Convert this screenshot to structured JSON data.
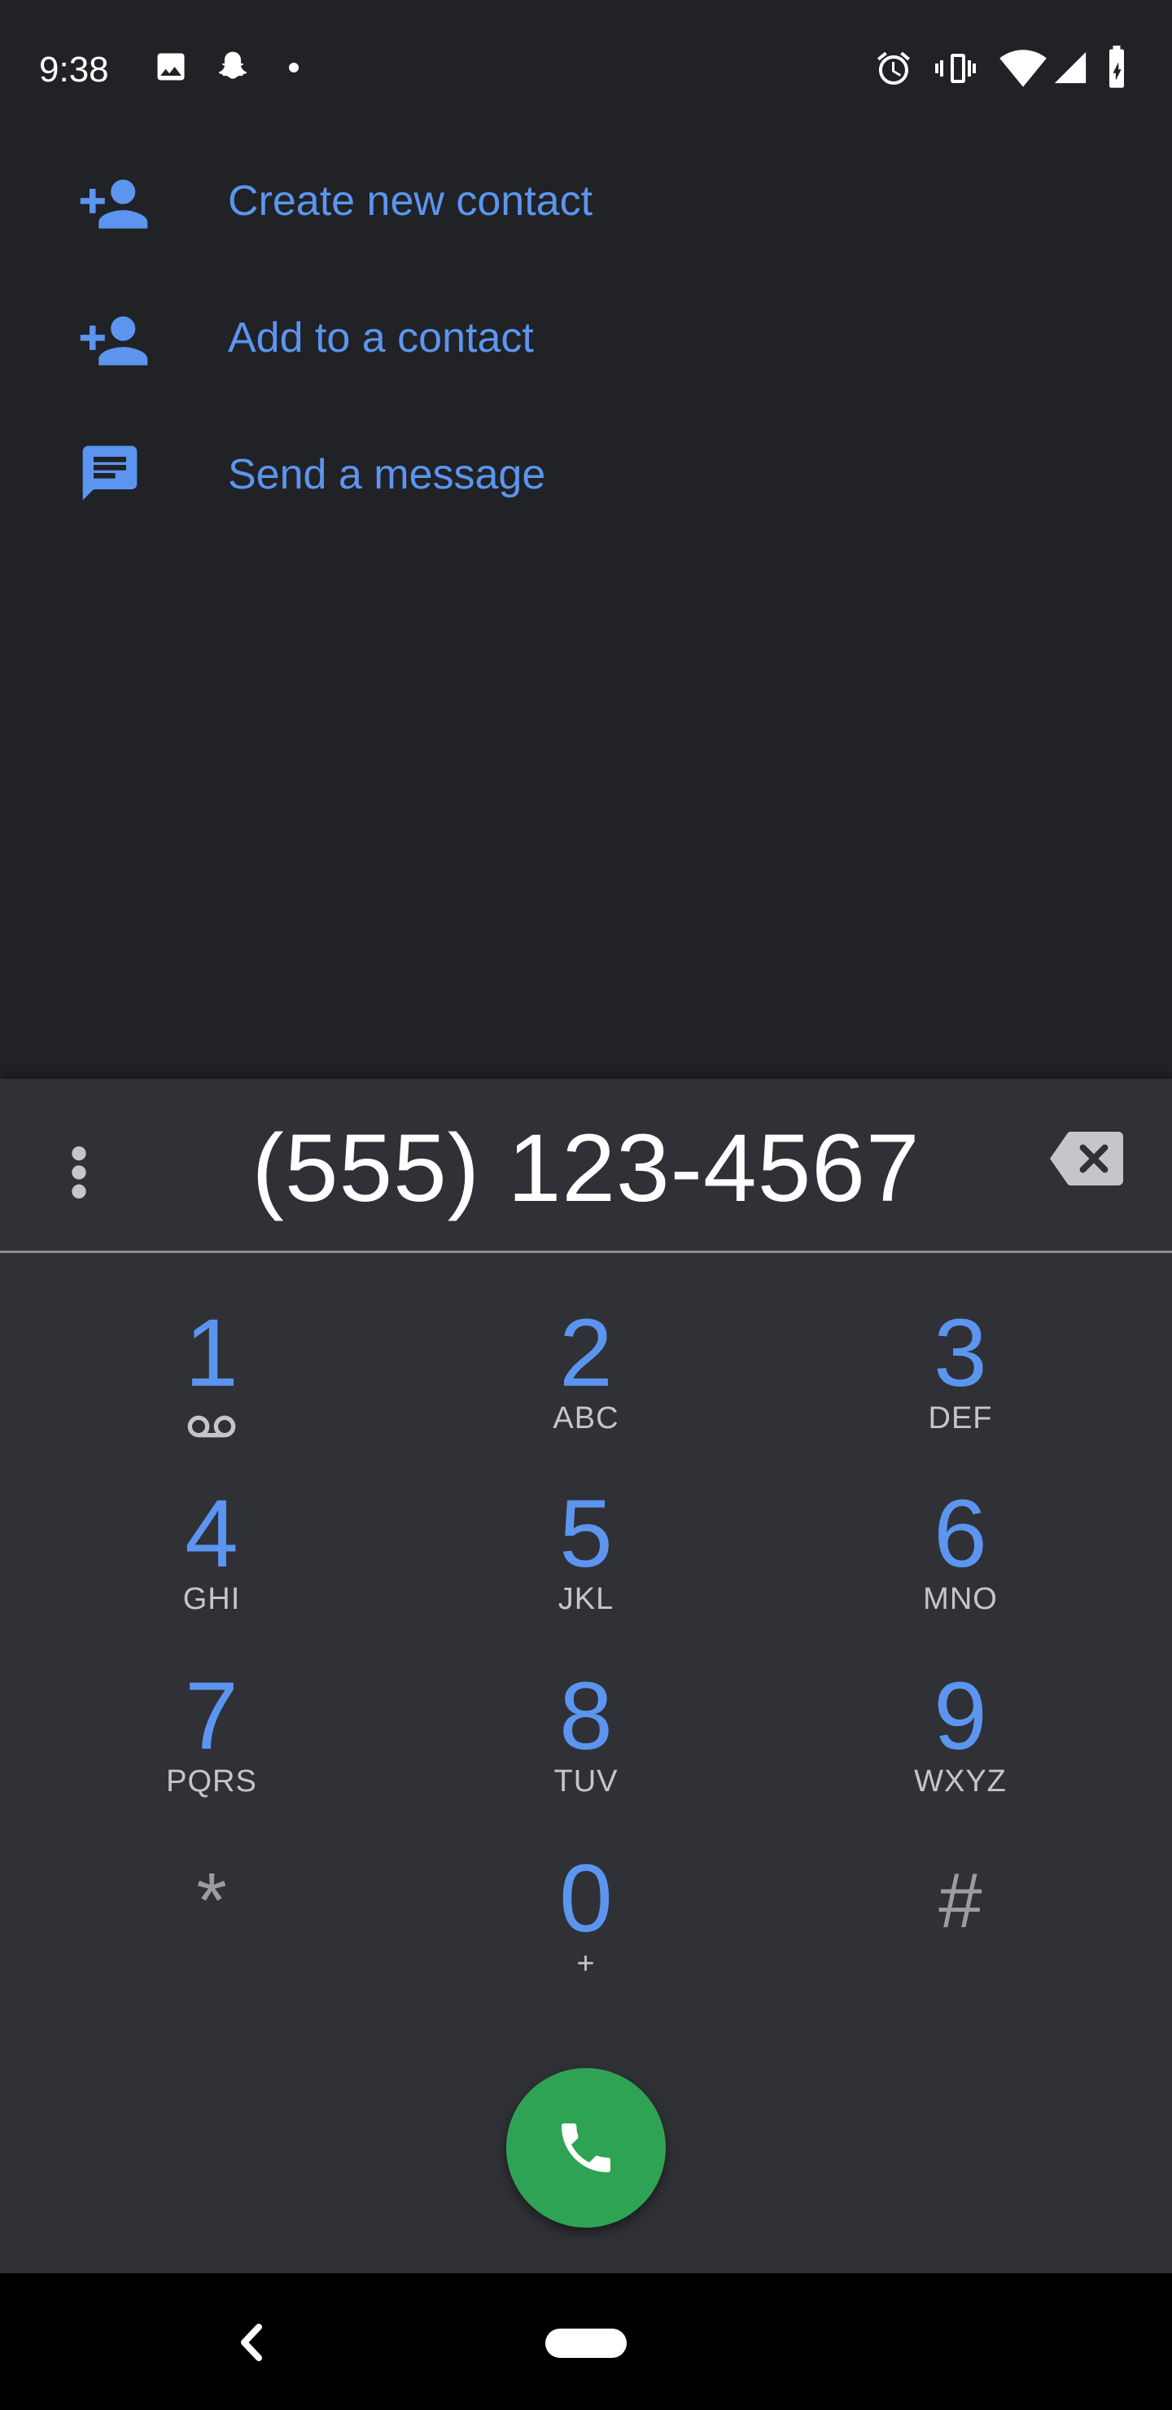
{
  "status_bar": {
    "time": "9:38",
    "icons": [
      "image-icon",
      "snapchat-icon",
      "dot-icon",
      "alarm-icon",
      "vibrate-icon",
      "wifi-icon",
      "signal-icon",
      "battery-charging-icon"
    ]
  },
  "suggestions": [
    {
      "label": "Create new contact",
      "icon": "person-add-icon"
    },
    {
      "label": "Add to a contact",
      "icon": "person-add-icon"
    },
    {
      "label": "Send a message",
      "icon": "message-icon"
    }
  ],
  "dialpad": {
    "digits": "(555) 123-4567",
    "keys": [
      {
        "num": "1",
        "letters": ""
      },
      {
        "num": "2",
        "letters": "ABC"
      },
      {
        "num": "3",
        "letters": "DEF"
      },
      {
        "num": "4",
        "letters": "GHI"
      },
      {
        "num": "5",
        "letters": "JKL"
      },
      {
        "num": "6",
        "letters": "MNO"
      },
      {
        "num": "7",
        "letters": "PQRS"
      },
      {
        "num": "8",
        "letters": "TUV"
      },
      {
        "num": "9",
        "letters": "WXYZ"
      },
      {
        "num": "*",
        "letters": ""
      },
      {
        "num": "0",
        "letters": "+"
      },
      {
        "num": "#",
        "letters": ""
      }
    ]
  },
  "colors": {
    "background": "#212226",
    "dialpad_background": "#303136",
    "accent_blue": "#5c95f0",
    "call_green": "#2fa354"
  }
}
